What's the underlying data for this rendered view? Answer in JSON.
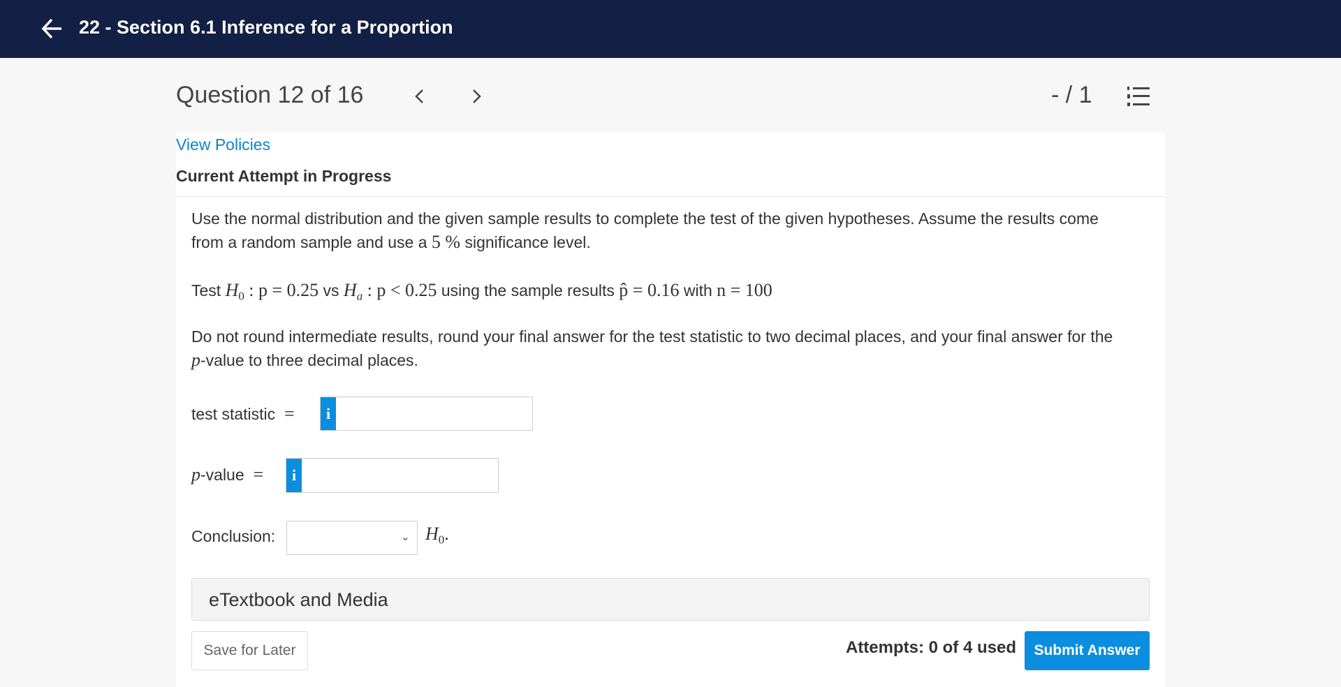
{
  "header": {
    "title": "22 - Section 6.1 Inference for a Proportion",
    "back_icon": "arrow-left-icon"
  },
  "question_nav": {
    "title": "Question 12 of 16",
    "prev_icon": "chevron-left-icon",
    "next_icon": "chevron-right-icon",
    "score": "- / 1",
    "list_icon": "numbered-list-icon"
  },
  "view_policies": "View Policies",
  "attempt_status": "Current Attempt in Progress",
  "question": {
    "intro_1": "Use the normal distribution and the given sample results to complete the test of the given hypotheses. Assume the results come",
    "intro_2a": "from a random sample and use a",
    "sig_level": "5 %",
    "intro_2b": "significance level.",
    "test_word": "Test",
    "h0": "H",
    "h0_sub": "0",
    "h0_expr": ": p = 0.25",
    "vs": "vs",
    "ha": "H",
    "ha_sub": "a",
    "ha_expr": ": p < 0.25",
    "using": "using the sample results",
    "phat": "p̂ = 0.16",
    "with": "with",
    "n_expr": "n = 100",
    "round_1": "Do not round intermediate results, round your final answer for the test statistic to two decimal places, and your final answer for the",
    "round_2_var": "p",
    "round_2": "-value to three decimal places."
  },
  "answers": {
    "test_statistic_label": "test statistic",
    "test_statistic_value": "",
    "pvalue_var": "p",
    "pvalue_label": "-value",
    "pvalue_value": "",
    "equals": "=",
    "info_label": "i",
    "conclusion_label": "Conclusion:",
    "conclusion_value": "",
    "conclusion_suffix_var": "H",
    "conclusion_suffix_sub": "0",
    "conclusion_suffix_end": "."
  },
  "etextbook": "eTextbook and Media",
  "footer": {
    "save": "Save for Later",
    "attempts": "Attempts: 0 of 4 used",
    "submit": "Submit Answer"
  },
  "colors": {
    "header_bg": "#141f45",
    "accent": "#0b8ee0",
    "link": "#0a84d0"
  }
}
